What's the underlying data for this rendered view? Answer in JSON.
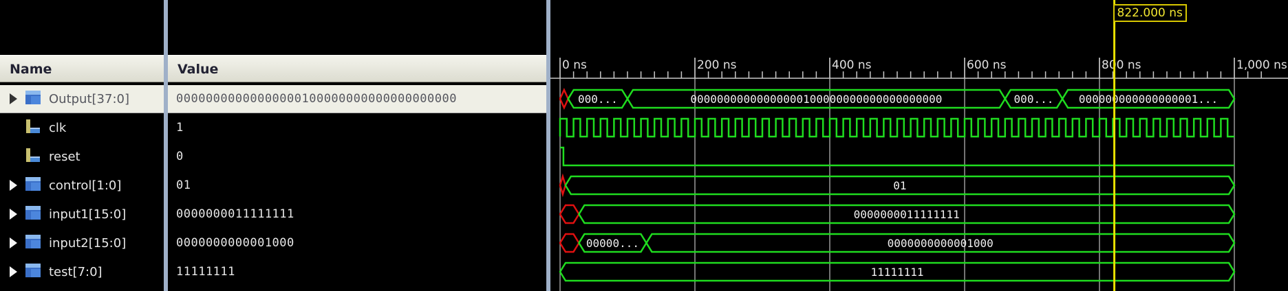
{
  "columns": {
    "name": "Name",
    "value": "Value"
  },
  "signals": [
    {
      "name": "Output[37:0]",
      "value": "00000000000000000100000000000000000000",
      "type": "bus",
      "icon": "bus-icon-blue",
      "selected": true
    },
    {
      "name": "clk",
      "value": "1",
      "type": "bit",
      "icon": "bit-signal-icon"
    },
    {
      "name": "reset",
      "value": "0",
      "type": "bit",
      "icon": "bit-signal-icon"
    },
    {
      "name": "control[1:0]",
      "value": "01",
      "type": "bus",
      "icon": "bus-icon"
    },
    {
      "name": "input1[15:0]",
      "value": "0000000011111111",
      "type": "bus",
      "icon": "bus-icon"
    },
    {
      "name": "input2[15:0]",
      "value": "0000000000001000",
      "type": "bus",
      "icon": "bus-icon"
    },
    {
      "name": "test[7:0]",
      "value": "11111111",
      "type": "bus",
      "icon": "bus-icon"
    }
  ],
  "timeline": {
    "labels": [
      "0 ns",
      "200 ns",
      "400 ns",
      "600 ns",
      "800 ns",
      "1,000 ns"
    ],
    "tick_values_ns": [
      0,
      200,
      400,
      600,
      800,
      1000
    ],
    "range_ns": [
      0,
      1040
    ],
    "sim_end_ns": 1000,
    "cursor_ns": 822.0,
    "cursor_label": "822.000 ns"
  },
  "waves": [
    {
      "kind": "bus",
      "segments": [
        {
          "start": 0,
          "end": 12,
          "label": "",
          "invalid": true
        },
        {
          "start": 12,
          "end": 100,
          "label": "000..."
        },
        {
          "start": 100,
          "end": 660,
          "label": "00000000000000000100000000000000000000"
        },
        {
          "start": 660,
          "end": 745,
          "label": "000..."
        },
        {
          "start": 745,
          "end": 1000,
          "label": "000000000000000001..."
        }
      ]
    },
    {
      "kind": "clock",
      "period_ns": 20,
      "end": 1000
    },
    {
      "kind": "bit",
      "transitions": [
        [
          0,
          1
        ],
        [
          5,
          0
        ]
      ],
      "end": 1000
    },
    {
      "kind": "bus",
      "segments": [
        {
          "start": 0,
          "end": 8,
          "label": "",
          "invalid": true
        },
        {
          "start": 8,
          "end": 1000,
          "label": "01"
        }
      ]
    },
    {
      "kind": "bus",
      "segments": [
        {
          "start": 0,
          "end": 28,
          "label": "",
          "invalid": true
        },
        {
          "start": 28,
          "end": 1000,
          "label": "0000000011111111"
        }
      ]
    },
    {
      "kind": "bus",
      "segments": [
        {
          "start": 0,
          "end": 28,
          "label": "",
          "invalid": true
        },
        {
          "start": 28,
          "end": 128,
          "label": "00000..."
        },
        {
          "start": 128,
          "end": 1000,
          "label": "0000000000001000"
        }
      ]
    },
    {
      "kind": "bus",
      "segments": [
        {
          "start": 0,
          "end": 1000,
          "label": "11111111"
        }
      ]
    }
  ],
  "colors": {
    "wave": "#1fdc1f",
    "invalid": "#e01010",
    "cursor": "#e8e000",
    "grid": "#9a9a9a",
    "background": "#000000"
  }
}
